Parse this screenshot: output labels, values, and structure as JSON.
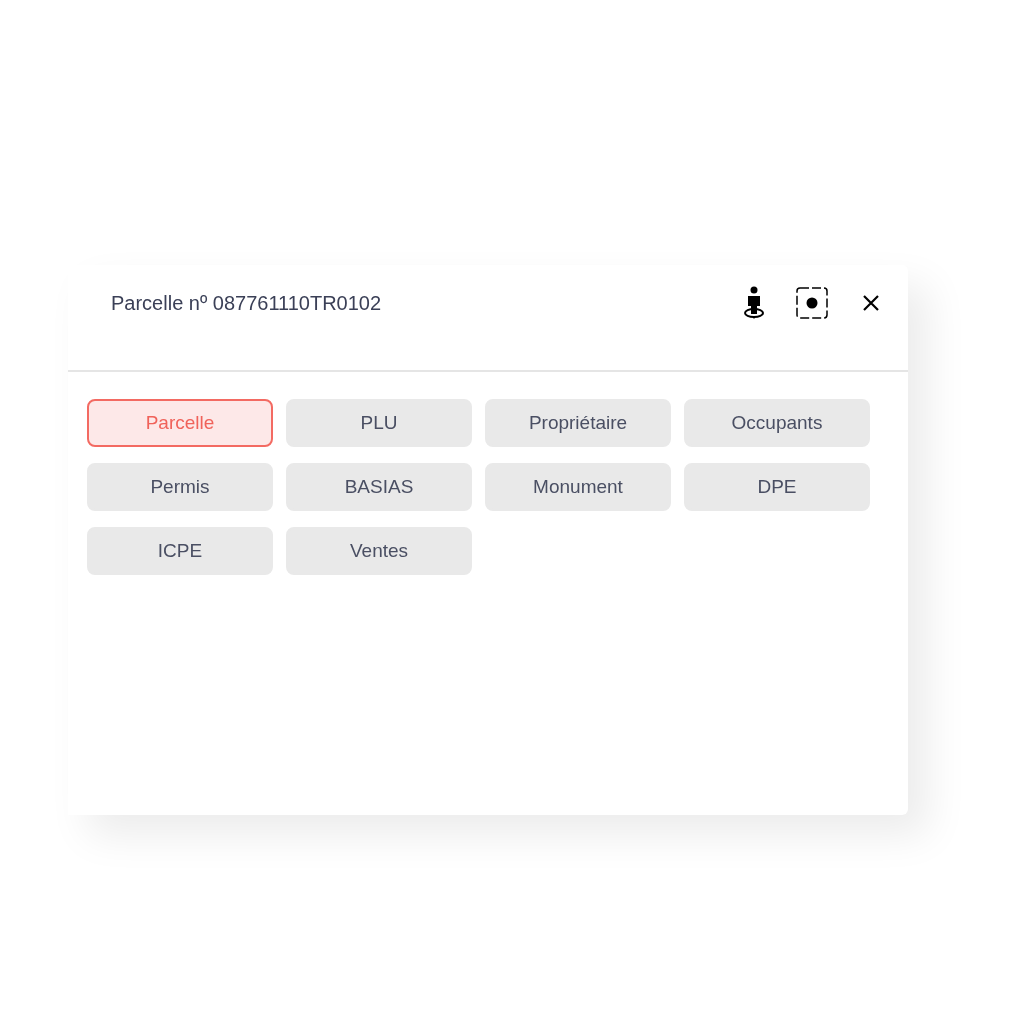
{
  "panel": {
    "title": "Parcelle nº 087761110TR0102"
  },
  "tabs": [
    {
      "label": "Parcelle",
      "selected": true
    },
    {
      "label": "PLU",
      "selected": false
    },
    {
      "label": "Propriétaire",
      "selected": false
    },
    {
      "label": "Occupants",
      "selected": false
    },
    {
      "label": "Permis",
      "selected": false
    },
    {
      "label": "BASIAS",
      "selected": false
    },
    {
      "label": "Monument",
      "selected": false
    },
    {
      "label": "DPE",
      "selected": false
    },
    {
      "label": "ICPE",
      "selected": false
    },
    {
      "label": "Ventes",
      "selected": false
    }
  ]
}
